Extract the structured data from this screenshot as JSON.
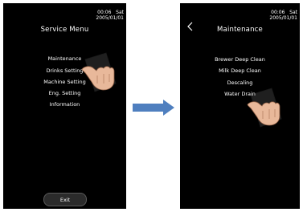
{
  "left_screen": {
    "status": {
      "time": "00:06",
      "day": "Sat",
      "date": "2005/01/01"
    },
    "title": "Service Menu",
    "menu": [
      "Maintenance",
      "Drinks Setting",
      "Machine Setting",
      "Eng. Setting",
      "Information"
    ],
    "exit_label": "Exit"
  },
  "right_screen": {
    "status": {
      "time": "00:06",
      "day": "Sat",
      "date": "2005/01/01"
    },
    "title": "Maintenance",
    "back_icon": "chevron-left-icon",
    "menu": [
      "Brewer Deep Clean",
      "Milk Deep Clean",
      "Descaling",
      "Water Drain"
    ]
  },
  "transition_arrow_color": "#4f7fbf"
}
